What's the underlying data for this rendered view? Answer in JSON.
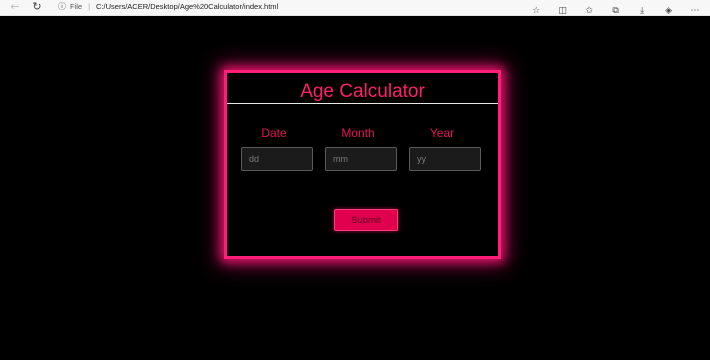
{
  "browser": {
    "address_label": "File",
    "url": "C:/Users/ACER/Desktop/Age%20Calculator/index.html",
    "icons": [
      "back-icon",
      "refresh-icon",
      "info-icon",
      "favorite-star-icon",
      "split-screen-icon",
      "favorites-icon",
      "collections-icon",
      "downloads-icon",
      "extension-icon",
      "more-icon"
    ]
  },
  "calculator": {
    "title": "Age Calculator",
    "labels": {
      "date": "Date",
      "month": "Month",
      "year": "Year"
    },
    "placeholders": {
      "date": "dd",
      "month": "mm",
      "year": "yy"
    },
    "submit_label": "Submit"
  },
  "colors": {
    "background": "#000000",
    "accent": "#ff1f7a",
    "label": "#e6125a",
    "button": "#e0004e"
  }
}
